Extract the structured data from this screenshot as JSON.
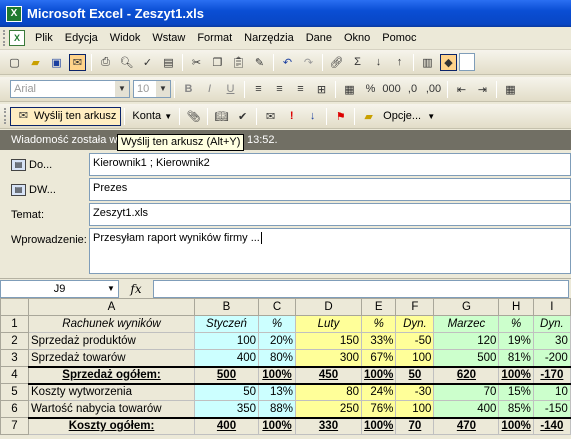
{
  "window": {
    "title": "Microsoft Excel - Zeszyt1.xls"
  },
  "menu": [
    "Plik",
    "Edycja",
    "Widok",
    "Wstaw",
    "Format",
    "Narzędzia",
    "Dane",
    "Okno",
    "Pomoc"
  ],
  "format_toolbar": {
    "font": "Arial",
    "size": "10"
  },
  "email_toolbar": {
    "send_label": "Wyślij ten arkusz",
    "accounts_label": "Konta",
    "options_label": "Opcje..."
  },
  "infobar": {
    "text": "Wiadomość została w",
    "time": "13:52."
  },
  "tooltip": "Wyślij ten arkusz (Alt+Y)",
  "email": {
    "to_label": "Do...",
    "to": "Kierownik1 ; Kierownik2",
    "cc_label": "DW...",
    "cc": "Prezes",
    "subject_label": "Temat:",
    "subject": "Zeszyt1.xls",
    "intro_label": "Wprowadzenie:",
    "intro": "Przesyłam raport wyników firmy ..."
  },
  "formula": {
    "cell": "J9",
    "fx": "fx",
    "value": ""
  },
  "columns": [
    "",
    "A",
    "B",
    "C",
    "D",
    "E",
    "F",
    "G",
    "H",
    "I"
  ],
  "rows": [
    {
      "n": "1",
      "cells": [
        "Rachunek wyników",
        "Styczeń",
        "%",
        "Luty",
        "%",
        "Dyn.",
        "Marzec",
        "%",
        "Dyn."
      ]
    },
    {
      "n": "2",
      "cells": [
        "Sprzedaż produktów",
        "100",
        "20%",
        "150",
        "33%",
        "-50",
        "120",
        "19%",
        "30"
      ]
    },
    {
      "n": "3",
      "cells": [
        "Sprzedaż towarów",
        "400",
        "80%",
        "300",
        "67%",
        "100",
        "500",
        "81%",
        "-200"
      ]
    },
    {
      "n": "4",
      "cells": [
        "Sprzedaż ogółem:",
        "500",
        "100%",
        "450",
        "100%",
        "50",
        "620",
        "100%",
        "-170"
      ]
    },
    {
      "n": "5",
      "cells": [
        "Koszty wytworzenia",
        "50",
        "13%",
        "80",
        "24%",
        "-30",
        "70",
        "15%",
        "10"
      ]
    },
    {
      "n": "6",
      "cells": [
        "Wartość nabycia towarów",
        "350",
        "88%",
        "250",
        "76%",
        "100",
        "400",
        "85%",
        "-150"
      ]
    },
    {
      "n": "7",
      "cells": [
        "Koszty ogółem:",
        "400",
        "100%",
        "330",
        "100%",
        "70",
        "470",
        "100%",
        "-140"
      ]
    }
  ]
}
